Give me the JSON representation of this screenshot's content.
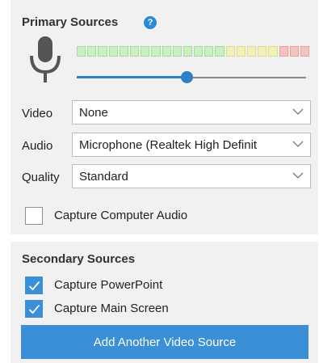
{
  "primary": {
    "title": "Primary Sources",
    "help_icon": "help-question-icon",
    "mic_icon": "microphone-icon",
    "meter": {
      "segment_colors": [
        "#c9efc3",
        "#c9efc3",
        "#c9efc3",
        "#c9efc3",
        "#c9efc3",
        "#c9efc3",
        "#c9efc3",
        "#c9efc3",
        "#c9efc3",
        "#c9efc3",
        "#c9efc3",
        "#c9efc3",
        "#c9efc3",
        "#c9efc3",
        "#f2f2b8",
        "#f2f2b8",
        "#f2f2b8",
        "#f2f2b8",
        "#f2f2b8",
        "#f7c2c2",
        "#f7c2c2",
        "#f7c2c2"
      ],
      "segment_border_colors": {
        "#c9efc3": "#a9dba0",
        "#f2f2b8": "#dcdc94",
        "#f7c2c2": "#e7a1a1"
      }
    },
    "volume_level": 0.48,
    "video": {
      "label": "Video",
      "value": "None"
    },
    "audio": {
      "label": "Audio",
      "value": "Microphone (Realtek High Definit"
    },
    "quality": {
      "label": "Quality",
      "value": "Standard"
    },
    "capture_computer_audio": {
      "label": "Capture Computer Audio",
      "checked": false
    }
  },
  "secondary": {
    "title": "Secondary Sources",
    "capture_powerpoint": {
      "label": "Capture PowerPoint",
      "checked": true
    },
    "capture_main_screen": {
      "label": "Capture Main Screen",
      "checked": true
    },
    "add_button_label": "Add Another Video Source"
  },
  "colors": {
    "accent": "#3a8fd6",
    "panel_bg": "#f1f1f1"
  }
}
